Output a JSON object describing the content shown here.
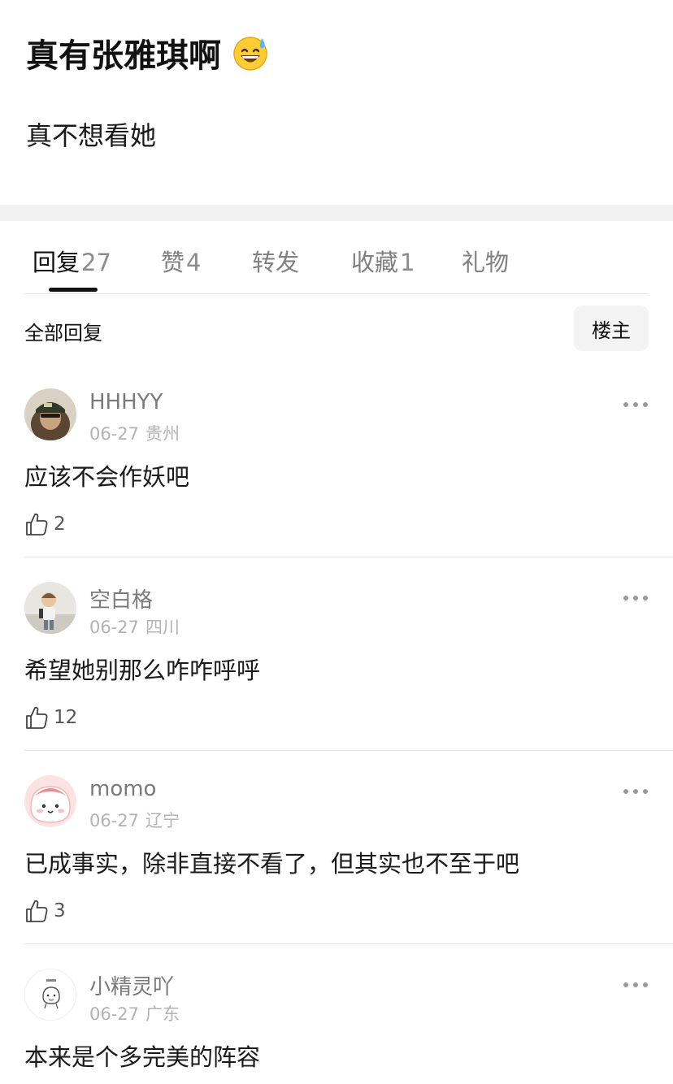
{
  "post": {
    "title": "真有张雅琪啊",
    "title_emoji": "grinning-sweat-emoji",
    "body": "真不想看她"
  },
  "tabs": [
    {
      "label": "回复",
      "count": "27",
      "active": true
    },
    {
      "label": "赞",
      "count": "4"
    },
    {
      "label": "转发",
      "count": ""
    },
    {
      "label": "收藏",
      "count": "1"
    },
    {
      "label": "礼物",
      "count": ""
    }
  ],
  "filter": {
    "title": "全部回复",
    "op_button": "楼主"
  },
  "comments": [
    {
      "user": "HHHYY",
      "date": "06-27",
      "location": "贵州",
      "text": "应该不会作妖吧",
      "likes": "2",
      "avatar": "avatar-photo-hat"
    },
    {
      "user": "空白格",
      "date": "06-27",
      "location": "四川",
      "text": "希望她别那么咋咋呼呼",
      "likes": "12",
      "avatar": "avatar-photo-child"
    },
    {
      "user": "momo",
      "date": "06-27",
      "location": "辽宁",
      "text": "已成事实，除非直接不看了，但其实也不至于吧",
      "likes": "3",
      "avatar": "avatar-pink-cartoon"
    },
    {
      "user": "小精灵吖",
      "date": "06-27",
      "location": "广东",
      "text": "本来是个多完美的阵容",
      "likes": "",
      "avatar": "avatar-doodle"
    }
  ],
  "colors": {
    "accent": "#111111",
    "muted": "#7a7a7a",
    "meta": "#b3b3b3",
    "divider": "#e6e6e6",
    "gap": "#f2f2f2"
  }
}
